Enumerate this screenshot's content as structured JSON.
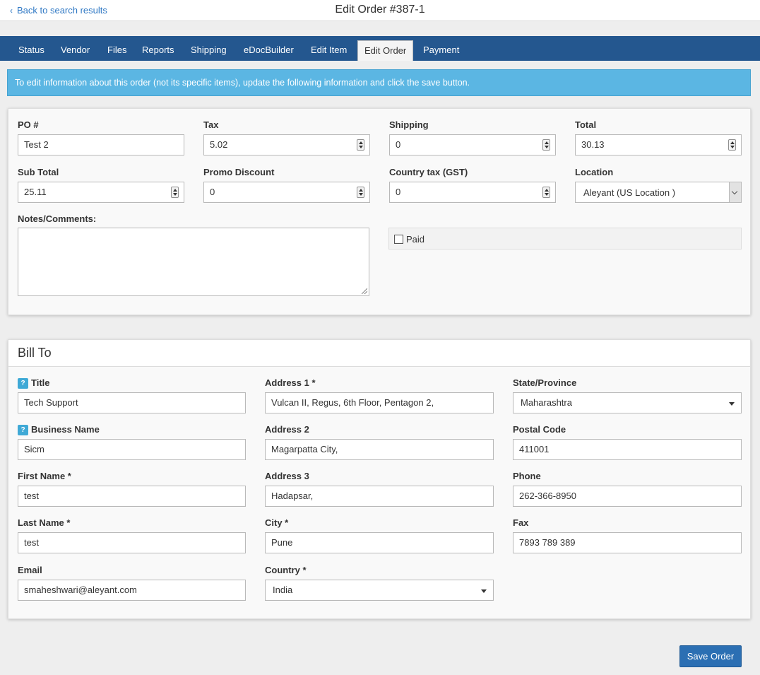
{
  "header": {
    "back_label": "Back to search results",
    "title": "Edit Order #387-1"
  },
  "tabs": [
    "Status",
    "Vendor",
    "Files",
    "Reports",
    "Shipping",
    "eDocBuilder",
    "Edit Item",
    "Edit Order",
    "Payment"
  ],
  "active_tab": "Edit Order",
  "info_message": "To edit information about this order (not its specific items), update the following information and click the save button.",
  "order": {
    "po_label": "PO #",
    "po_value": "Test 2",
    "tax_label": "Tax",
    "tax_value": "5.02",
    "shipping_label": "Shipping",
    "shipping_value": "0",
    "total_label": "Total",
    "total_value": "30.13",
    "subtotal_label": "Sub Total",
    "subtotal_value": "25.11",
    "promo_label": "Promo Discount",
    "promo_value": "0",
    "country_tax_label": "Country tax (GST)",
    "country_tax_value": "0",
    "location_label": "Location",
    "location_value": "Aleyant (US Location )",
    "notes_label": "Notes/Comments:",
    "notes_value": "",
    "paid_label": "Paid",
    "paid_checked": false
  },
  "bill_to": {
    "heading": "Bill To",
    "help_glyph": "?",
    "title_label": "Title",
    "title_value": "Tech Support",
    "business_label": "Business Name",
    "business_value": "Sicm",
    "first_name_label": "First Name *",
    "first_name_value": "test",
    "last_name_label": "Last Name *",
    "last_name_value": "test",
    "email_label": "Email",
    "email_value": "smaheshwari@aleyant.com",
    "address1_label": "Address 1 *",
    "address1_value": "Vulcan II, Regus, 6th Floor, Pentagon 2,",
    "address2_label": "Address 2",
    "address2_value": "Magarpatta City,",
    "address3_label": "Address 3",
    "address3_value": "Hadapsar,",
    "city_label": "City *",
    "city_value": "Pune",
    "country_label": "Country *",
    "country_value": "India",
    "state_label": "State/Province",
    "state_value": "Maharashtra",
    "postal_label": "Postal Code",
    "postal_value": "411001",
    "phone_label": "Phone",
    "phone_value": "262-366-8950",
    "fax_label": "Fax",
    "fax_value": "7893 789 389"
  },
  "save_label": "Save Order",
  "colors": {
    "nav_bar": "#24578f",
    "info_banner": "#5bb6e3",
    "primary_button": "#2b6fb3",
    "link": "#2f78c4"
  }
}
